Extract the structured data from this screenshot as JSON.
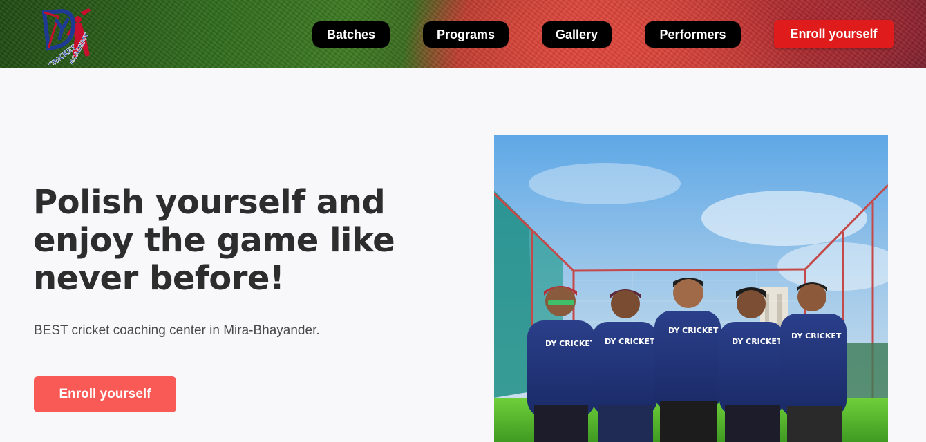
{
  "header": {
    "logo": {
      "text_line1": "CRICKET",
      "text_line2": "ACADEMY",
      "monogram": "DY",
      "icon": "cricket-batsman-logo"
    },
    "nav": [
      {
        "label": "Batches"
      },
      {
        "label": "Programs"
      },
      {
        "label": "Gallery"
      },
      {
        "label": "Performers"
      }
    ],
    "enroll_label": "Enroll yourself",
    "colors": {
      "nav_bg": "#000000",
      "enroll_bg": "#e01b1b"
    }
  },
  "hero": {
    "title_lines": [
      "Polish yourself and",
      "enjoy the game like",
      "never before!"
    ],
    "subtitle": "BEST cricket coaching center in Mira-Bhayander.",
    "cta_label": "Enroll yourself",
    "cta_color": "#fa5a56",
    "photo": {
      "description_icon": "team-photo",
      "jersey_text": [
        "DY CRICKET",
        "DY CRICKET",
        "DY CRICKET",
        "DY CRICKET",
        "DY CRICKET"
      ]
    }
  }
}
